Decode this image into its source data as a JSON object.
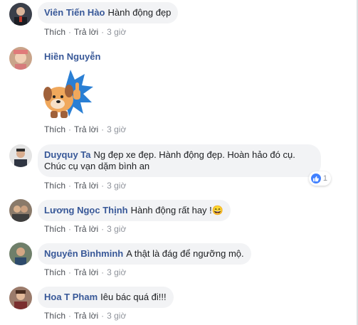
{
  "actions": {
    "like": "Thích",
    "reply": "Trả lời",
    "sep": "·"
  },
  "comments": [
    {
      "name": "Viên Tiến Hào",
      "text": "Hành động đẹp",
      "time": "3 giờ"
    },
    {
      "name": "Hiền Nguyễn",
      "text": "",
      "time": "3 giờ",
      "sticker": "dog-thumbs-up-sticker"
    },
    {
      "name": "Duyquy Ta",
      "text": "Ng đẹp xe đẹp. Hành động đẹp. Hoàn hảo đó cụ. Chúc cụ vạn dặm bình an",
      "time": "3 giờ",
      "reaction_count": "1"
    },
    {
      "name": "Lương Ngọc Thịnh",
      "text": "Hành động rất hay !😄",
      "time": "3 giờ"
    },
    {
      "name": "Nguyên Bìnhminh",
      "text": "A thật là đág để ngưỡng mộ.",
      "time": "3 giờ"
    },
    {
      "name": "Hoa T Pham",
      "text": "Iêu bác quá đi!!!",
      "time": "3 giờ"
    }
  ],
  "colors": {
    "name": "#385898",
    "bubble": "#f2f3f5",
    "like_badge": "#4080ff",
    "meta": "#90949c"
  }
}
